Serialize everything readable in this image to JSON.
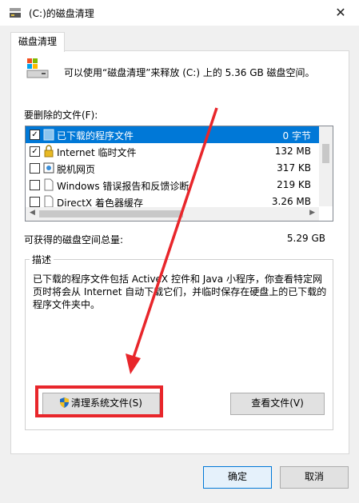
{
  "window": {
    "title": "(C:)的磁盘清理",
    "close_glyph": "✕"
  },
  "tab": {
    "label": "磁盘清理"
  },
  "intro_text": "可以使用“磁盘清理”来释放  (C:) 上的 5.36 GB 磁盘空间。",
  "files": {
    "label": "要删除的文件(F):",
    "rows": [
      {
        "name": "已下载的程序文件",
        "size": "0 字节",
        "checked": true,
        "selected": true,
        "icon": "folder-icon"
      },
      {
        "name": "Internet 临时文件",
        "size": "132 MB",
        "checked": true,
        "selected": false,
        "icon": "lock-icon"
      },
      {
        "name": "脱机网页",
        "size": "317 KB",
        "checked": false,
        "selected": false,
        "icon": "offline-page-icon"
      },
      {
        "name": "Windows 错误报告和反馈诊断",
        "size": "219 KB",
        "checked": false,
        "selected": false,
        "icon": "file-icon"
      },
      {
        "name": "DirectX 着色器缓存",
        "size": "3.26 MB",
        "checked": false,
        "selected": false,
        "icon": "file-icon"
      }
    ]
  },
  "space_gain": {
    "label": "可获得的磁盘空间总量:",
    "value": "5.29 GB"
  },
  "description": {
    "title": "描述",
    "text": "已下载的程序文件包括 ActiveX 控件和 Java 小程序，你查看特定网页时将会从 Internet 自动下载它们，并临时保存在硬盘上的已下载的程序文件夹中。"
  },
  "buttons": {
    "clean_system": "清理系统文件(S)",
    "view_files": "查看文件(V)",
    "ok": "确定",
    "cancel": "取消"
  },
  "colors": {
    "selection": "#0078d7",
    "annotation": "#e8262b"
  }
}
